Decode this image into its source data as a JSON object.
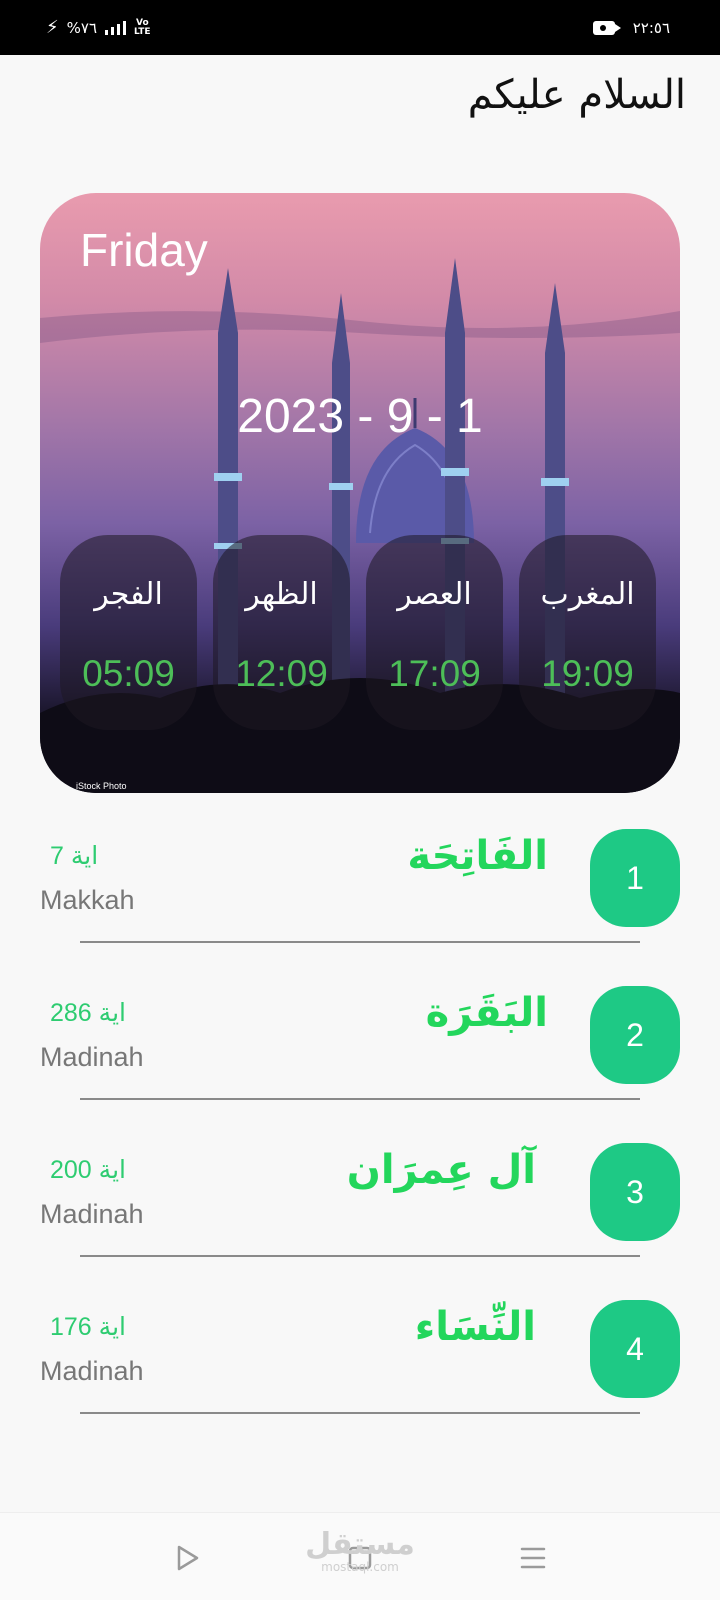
{
  "status_bar": {
    "battery": "%٧٦",
    "network": "Vo LTE",
    "time": "٢٢:٥٦"
  },
  "greeting": "السلام عليكم",
  "hero": {
    "day": "Friday",
    "date": "2023 - 9 - 1",
    "image_credit": "iStock Photo",
    "prayers": [
      {
        "name": "المغرب",
        "time": "19:09"
      },
      {
        "name": "العصر",
        "time": "17:09"
      },
      {
        "name": "الظهر",
        "time": "12:09"
      },
      {
        "name": "الفجر",
        "time": "05:09"
      }
    ]
  },
  "surahs": [
    {
      "number": "1",
      "name": "الفَاتِحَة",
      "ayah_word": "اية",
      "ayah_count": "7",
      "place": "Makkah"
    },
    {
      "number": "2",
      "name": "البَقَرَة",
      "ayah_word": "اية",
      "ayah_count": "286",
      "place": "Madinah"
    },
    {
      "number": "3",
      "name": "آل عِمرَان",
      "ayah_word": "اية",
      "ayah_count": "200",
      "place": "Madinah"
    },
    {
      "number": "4",
      "name": "النِّسَاء",
      "ayah_word": "اية",
      "ayah_count": "176",
      "place": "Madinah"
    }
  ],
  "bottom_nav": {
    "watermark_ar": "مستقل",
    "watermark_en": "mostaql.com",
    "icons": [
      "play-icon",
      "square-icon",
      "menu-icon"
    ]
  },
  "colors": {
    "accent_green": "#1ec985",
    "surah_name_green": "#23d65c",
    "prayer_time_green": "#4dbe58"
  }
}
